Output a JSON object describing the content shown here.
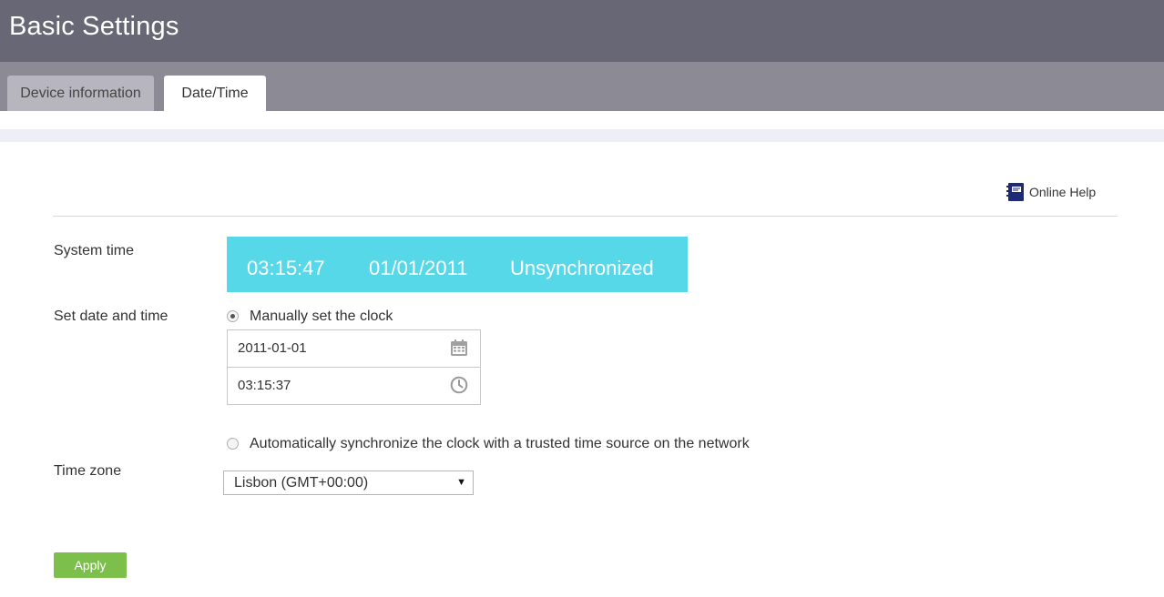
{
  "header": {
    "title": "Basic Settings"
  },
  "tabs": [
    {
      "label": "Device information",
      "active": false
    },
    {
      "label": "Date/Time",
      "active": true
    }
  ],
  "help": {
    "label": "Online Help",
    "icon": "book-icon"
  },
  "system_time": {
    "label": "System time",
    "time": "03:15:47",
    "date": "01/01/2011",
    "status": "Unsynchronized",
    "bg_color": "#57d8e8"
  },
  "set_datetime": {
    "label": "Set date and time",
    "manual_option": "Manually set the clock",
    "manual_selected": true,
    "date_value": "2011-01-01",
    "time_value": "03:15:37",
    "auto_option": "Automatically synchronize the clock with a trusted time source on the network",
    "auto_selected": false
  },
  "timezone": {
    "label": "Time zone",
    "selected": "Lisbon (GMT+00:00)"
  },
  "apply_label": "Apply",
  "colors": {
    "header_bg": "#676775",
    "tabbar_bg": "#8c8b95",
    "apply_bg": "#7cc04b"
  }
}
